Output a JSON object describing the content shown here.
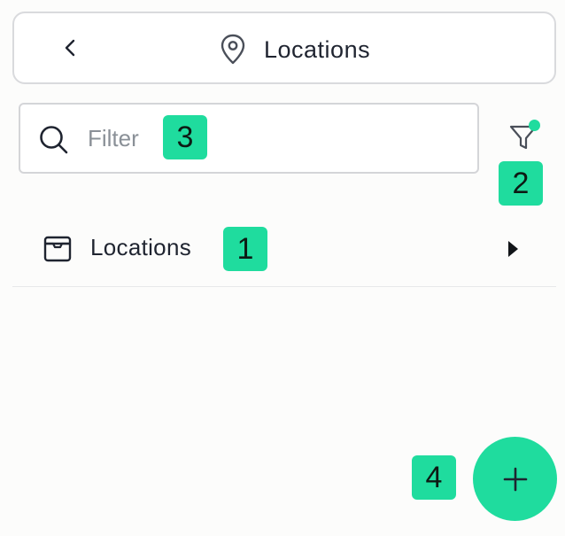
{
  "header": {
    "title": "Locations",
    "back_icon": "chevron-left-icon",
    "location_icon": "map-pin-icon"
  },
  "filter": {
    "placeholder": "Filter",
    "value": "",
    "search_icon": "search-icon",
    "filter_icon": "funnel-icon",
    "active_indicator_color": "#1fdc9e"
  },
  "list": {
    "items": [
      {
        "label": "Locations",
        "icon": "archive-box-icon",
        "trailing_icon": "caret-right-icon"
      }
    ]
  },
  "fab": {
    "icon": "plus-icon",
    "color": "#1fdc9e"
  },
  "badges": [
    "1",
    "2",
    "3",
    "4"
  ],
  "colors": {
    "accent": "#1fdc9e",
    "text": "#1f2430",
    "placeholder": "#8a9097",
    "border": "#d9dadd"
  }
}
